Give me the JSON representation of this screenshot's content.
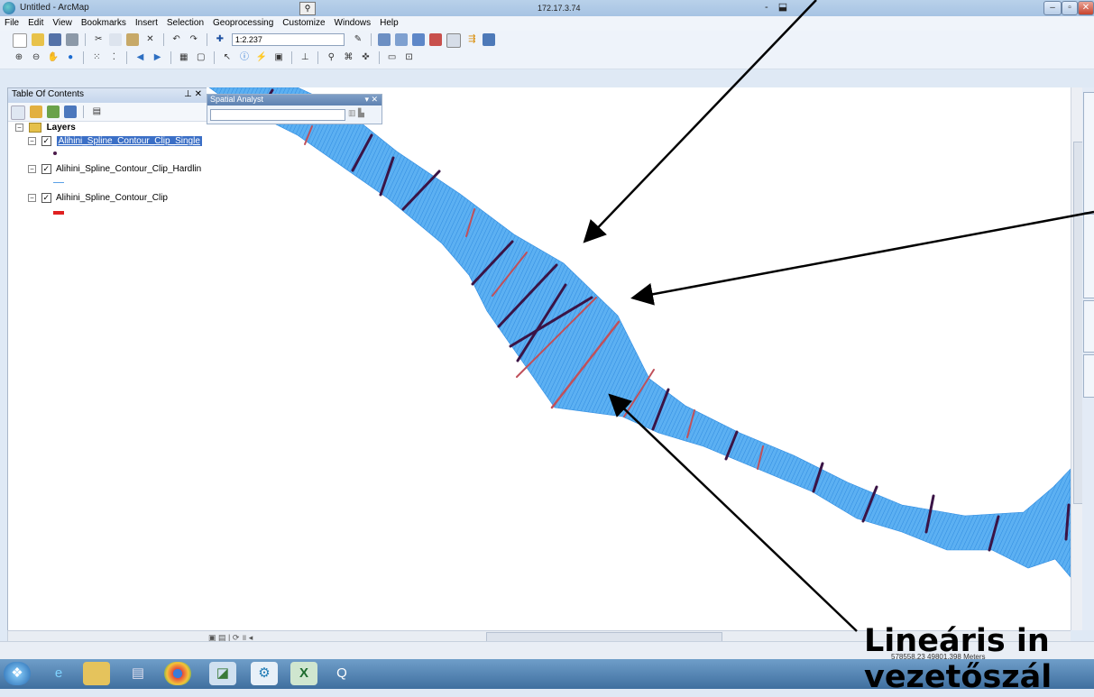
{
  "window": {
    "title": "Untitled - ArcMap",
    "remote_ip": "172.17.3.74",
    "rdp_controls": "- ⬓",
    "buttons": {
      "minimize": "–",
      "maximize": "▫",
      "close": "✕"
    }
  },
  "menu": [
    "File",
    "Edit",
    "View",
    "Bookmarks",
    "Insert",
    "Selection",
    "Geoprocessing",
    "Customize",
    "Windows",
    "Help"
  ],
  "toolbar": {
    "scale": "1:2.237"
  },
  "toc": {
    "title": "Table Of Contents",
    "controls": "⊥ ✕",
    "group": "Layers",
    "layers": [
      {
        "name": "Alihini_Spline_Contour_Clip_Single",
        "selected": true,
        "checked": "✓",
        "symbol_color": "#4b1a4a"
      },
      {
        "name": "Alihini_Spline_Contour_Clip_Hardlin",
        "selected": false,
        "checked": "✓",
        "symbol_color": "#5aa0e6"
      },
      {
        "name": "Alihini_Spline_Contour_Clip",
        "selected": false,
        "checked": "✓",
        "symbol_color": "#e02020"
      }
    ]
  },
  "spatial_analyst": {
    "title": "Spatial Analyst",
    "controls": "▾ ✕"
  },
  "statusbar": {
    "coordinates": "578558.23  49801.398 Meters"
  },
  "caption": {
    "line1": "Lineáris in",
    "line2": "vezetőszál"
  },
  "colors": {
    "tin_fill": "#4aa7ee",
    "contour_dark": "#3a1446",
    "contour_red": "#c0505a",
    "arrow": "#000000"
  },
  "taskbar_icons": [
    "start-orb-icon",
    "internet-explorer-icon",
    "folder-icon",
    "media-icon",
    "chrome-icon",
    "chart-icon",
    "network-icon",
    "excel-icon",
    "qgis-icon"
  ]
}
